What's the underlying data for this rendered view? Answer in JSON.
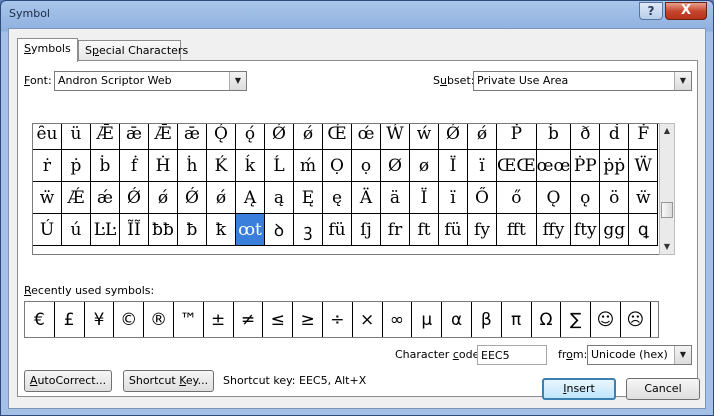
{
  "window": {
    "title": "Symbol",
    "close_glyph": "X",
    "help_glyph": "?"
  },
  "tabs": [
    {
      "label": "Symbols",
      "mnemonic": "S",
      "rest": "ymbols"
    },
    {
      "label": "Special Characters",
      "pre": "S",
      "mnemonic": "p",
      "rest": "ecial Characters"
    }
  ],
  "font": {
    "label": "Font:",
    "mnemonic": "F",
    "rest": "ont:",
    "value": "Andron Scriptor Web"
  },
  "subset": {
    "label": "Subset:",
    "pre": "S",
    "mnemonic": "u",
    "rest": "bset:",
    "value": "Private Use Area"
  },
  "symbol_grid": {
    "rows": [
      [
        "ȇu",
        "ü",
        "Ǣ",
        "ǣ",
        "Ǣ",
        "ǣ",
        "Ǫ́",
        "ǫ́",
        "Ǿ",
        "ǿ",
        "Œ́",
        "œ́",
        "Ẃ",
        "ẃ",
        "Ǿ",
        "ǿ",
        "Ṗ",
        "ḃ",
        "ð",
        "ḋ",
        "Ḟ"
      ],
      [
        "ṙ",
        "ṗ",
        "ḃ",
        "ḟ",
        "Ḣ",
        "ḣ",
        "Ḱ",
        "ḱ",
        "Ĺ",
        "ḿ",
        "Ọ",
        "ọ",
        "Ø",
        "ø",
        "Ï",
        "ï",
        "ŒŒ",
        "œœ",
        "ṖP",
        "ṗṗ",
        "Ẅ"
      ],
      [
        "ẅ",
        "Ǽ",
        "ǽ",
        "Ǿ",
        "ǿ",
        "Ǿ",
        "ǿ",
        "Ą",
        "ą",
        "Ę",
        "ę",
        "Ä",
        "ä",
        "Ï",
        "ï",
        "Ő",
        "ő",
        "Ǫ",
        "ǫ",
        "ö",
        "ẅ"
      ],
      [
        "Ú",
        "ú",
        "ĿĿ",
        "ĨĨ",
        "ƀƀ",
        "ƀ",
        "ꝁ",
        "ꝏt",
        "ꝺ",
        "ꝫ",
        "fü",
        "ſj",
        "fr",
        "ft",
        "fü",
        "fy",
        "fft",
        "ffy",
        "fty",
        "gg",
        "ꝗ"
      ]
    ],
    "selected": "ꝏt"
  },
  "recent": {
    "label": "Recently used symbols:",
    "mnemonic": "R",
    "rest": "ecently used symbols:",
    "symbols": [
      "€",
      "£",
      "¥",
      "©",
      "®",
      "™",
      "±",
      "≠",
      "≤",
      "≥",
      "÷",
      "×",
      "∞",
      "µ",
      "α",
      "β",
      "π",
      "Ω",
      "∑",
      "☺",
      "☹"
    ]
  },
  "character_code": {
    "label": "Character code:",
    "pre": "Character ",
    "mnemonic": "c",
    "rest": "ode:",
    "value": "EEC5"
  },
  "from": {
    "label": "from:",
    "pre": "fr",
    "mnemonic": "o",
    "rest": "m:",
    "value": "Unicode (hex)"
  },
  "buttons": {
    "autocorrect": {
      "label": "AutoCorrect...",
      "pre": "",
      "mnemonic": "A",
      "rest": "utoCorrect..."
    },
    "shortcut_key": {
      "label": "Shortcut Key...",
      "pre": "Shortcut ",
      "mnemonic": "K",
      "rest": "ey..."
    },
    "insert": {
      "label": "Insert",
      "pre": "",
      "mnemonic": "I",
      "rest": "nsert"
    },
    "cancel": {
      "label": "Cancel"
    }
  },
  "shortcut_text": "Shortcut key: EEC5, Alt+X",
  "icons": {
    "dropdown_arrow": "▼",
    "scroll_up": "▲",
    "scroll_down": "▼"
  }
}
